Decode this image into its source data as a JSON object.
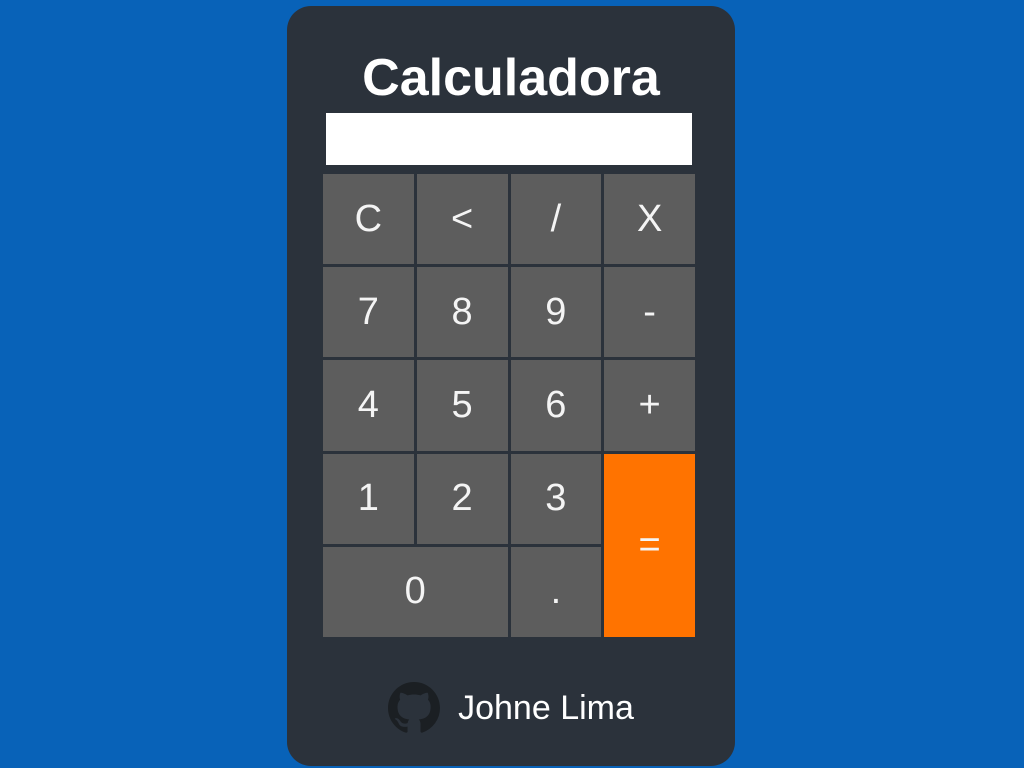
{
  "app": {
    "title": "Calculadora",
    "display_value": ""
  },
  "keys": [
    {
      "id": "clear",
      "label": "C"
    },
    {
      "id": "backspace",
      "label": "<"
    },
    {
      "id": "divide",
      "label": "/"
    },
    {
      "id": "multiply",
      "label": "X"
    },
    {
      "id": "seven",
      "label": "7"
    },
    {
      "id": "eight",
      "label": "8"
    },
    {
      "id": "nine",
      "label": "9"
    },
    {
      "id": "subtract",
      "label": "-"
    },
    {
      "id": "four",
      "label": "4"
    },
    {
      "id": "five",
      "label": "5"
    },
    {
      "id": "six",
      "label": "6"
    },
    {
      "id": "add",
      "label": "+"
    },
    {
      "id": "one",
      "label": "1"
    },
    {
      "id": "two",
      "label": "2"
    },
    {
      "id": "three",
      "label": "3"
    },
    {
      "id": "equals",
      "label": "="
    },
    {
      "id": "zero",
      "label": "0"
    },
    {
      "id": "decimal",
      "label": "."
    }
  ],
  "footer": {
    "author": "Johne Lima",
    "icon": "github-icon"
  },
  "colors": {
    "background": "#0862b8",
    "card": "#2b323b",
    "key": "#5d5d5d",
    "accent": "#ff7300",
    "display": "#ffffff"
  }
}
